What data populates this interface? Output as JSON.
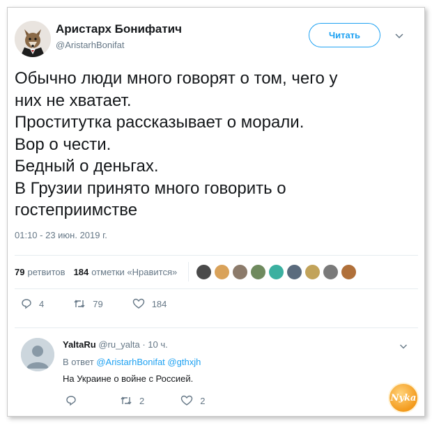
{
  "author": {
    "name": "Аристарх Бонифатич",
    "handle": "@AristarhBonifat"
  },
  "follow_label": "Читать",
  "tweet": {
    "lines": [
      "Обычно люди много говорят о том, чего у",
      "них не хватает.",
      "Проститутка рассказывает о морали.",
      "Вор о чести.",
      "Бедный о деньгах.",
      "В Грузии принято много говорить о",
      "гостеприимстве"
    ],
    "timestamp": "01:10 - 23 июн. 2019 г."
  },
  "stats": {
    "retweets_count": "79",
    "retweets_label": "ретвитов",
    "likes_count": "184",
    "likes_label": "отметки «Нравится»"
  },
  "liker_colors": [
    "#4a4a4a",
    "#d9a25a",
    "#8c7b6b",
    "#6f8a5e",
    "#3bb0a0",
    "#5a6b7d",
    "#c2a35a",
    "#7a7a7a",
    "#b0703a"
  ],
  "actions": {
    "replies": "4",
    "retweets": "79",
    "likes": "184"
  },
  "reply": {
    "name": "YaltaRu",
    "handle_time": "@ru_yalta · 10 ч.",
    "replying_prefix": "В ответ",
    "mention1": "@AristarhBonifat",
    "mention2": "@gthxjh",
    "text": "На Украине о войне с Россией.",
    "actions": {
      "replies": "",
      "retweets": "2",
      "likes": "2"
    }
  },
  "watermark": "Nyka"
}
